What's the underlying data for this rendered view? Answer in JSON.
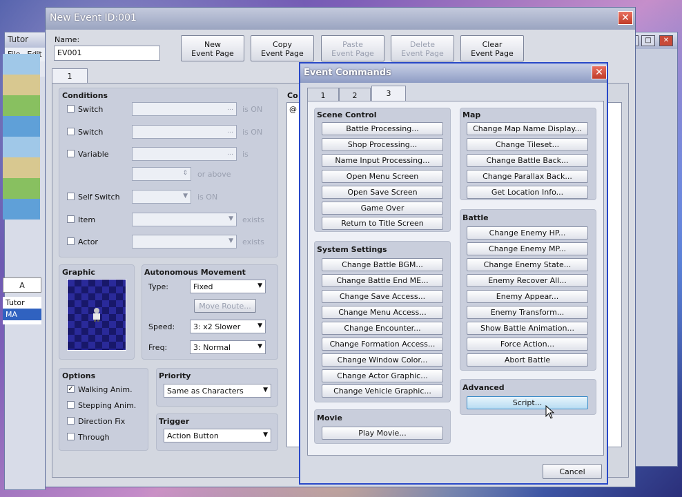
{
  "back_window": {
    "title": "Tutor",
    "menu": [
      "File",
      "Edit"
    ],
    "tab": "A",
    "tree": [
      {
        "label": "Tutor",
        "selected": false
      },
      {
        "label": "MA",
        "selected": true
      }
    ]
  },
  "main_window": {
    "title": "New Event   ID:001",
    "name_label": "Name:",
    "name_value": "EV001",
    "page_buttons": [
      {
        "label": "New\nEvent Page",
        "enabled": true
      },
      {
        "label": "Copy\nEvent Page",
        "enabled": true
      },
      {
        "label": "Paste\nEvent Page",
        "enabled": false
      },
      {
        "label": "Delete\nEvent Page",
        "enabled": false
      },
      {
        "label": "Clear\nEvent Page",
        "enabled": true
      }
    ],
    "page_tab": "1",
    "conditions": {
      "title": "Conditions",
      "switch1": {
        "label": "Switch",
        "suffix": "is ON",
        "dots": "..."
      },
      "switch2": {
        "label": "Switch",
        "suffix": "is ON",
        "dots": "..."
      },
      "variable": {
        "label": "Variable",
        "suffix": "is",
        "dots": "...",
        "above": "or above"
      },
      "self_switch": {
        "label": "Self Switch",
        "suffix": "is ON"
      },
      "item": {
        "label": "Item",
        "suffix": "exists"
      },
      "actor": {
        "label": "Actor",
        "suffix": "exists"
      }
    },
    "graphic": {
      "title": "Graphic"
    },
    "autonomous": {
      "title": "Autonomous Movement",
      "type_label": "Type:",
      "type_value": "Fixed",
      "move_route": "Move Route...",
      "speed_label": "Speed:",
      "speed_value": "3: x2 Slower",
      "freq_label": "Freq:",
      "freq_value": "3: Normal"
    },
    "options": {
      "title": "Options",
      "items": [
        {
          "label": "Walking Anim.",
          "checked": true
        },
        {
          "label": "Stepping Anim.",
          "checked": false
        },
        {
          "label": "Direction Fix",
          "checked": false
        },
        {
          "label": "Through",
          "checked": false
        }
      ]
    },
    "priority": {
      "title": "Priority",
      "value": "Same as Characters"
    },
    "trigger": {
      "title": "Trigger",
      "value": "Action Button"
    },
    "contents_label": "Co",
    "contents_first": "@"
  },
  "event_commands": {
    "title": "Event Commands",
    "tabs": [
      "1",
      "2",
      "3"
    ],
    "active_tab": "3",
    "scene_control": {
      "title": "Scene Control",
      "items": [
        "Battle Processing...",
        "Shop Processing...",
        "Name Input Processing...",
        "Open Menu Screen",
        "Open Save Screen",
        "Game Over",
        "Return to Title Screen"
      ]
    },
    "system_settings": {
      "title": "System Settings",
      "items": [
        "Change Battle BGM...",
        "Change Battle End ME...",
        "Change Save Access...",
        "Change Menu Access...",
        "Change Encounter...",
        "Change Formation Access...",
        "Change Window Color...",
        "Change Actor Graphic...",
        "Change Vehicle Graphic..."
      ]
    },
    "movie": {
      "title": "Movie",
      "items": [
        "Play Movie..."
      ]
    },
    "map": {
      "title": "Map",
      "items": [
        "Change Map Name Display...",
        "Change Tileset...",
        "Change Battle Back...",
        "Change Parallax Back...",
        "Get Location Info..."
      ]
    },
    "battle": {
      "title": "Battle",
      "items": [
        "Change Enemy HP...",
        "Change Enemy MP...",
        "Change Enemy State...",
        "Enemy Recover All...",
        "Enemy Appear...",
        "Enemy Transform...",
        "Show Battle Animation...",
        "Force Action...",
        "Abort Battle"
      ]
    },
    "advanced": {
      "title": "Advanced",
      "items": [
        "Script..."
      ]
    },
    "cancel": "Cancel"
  },
  "colors": {
    "accent_border": "#2848c8",
    "close_red": "#c03a28",
    "highlight": "#b8dcf2"
  },
  "icons": [
    "close-icon",
    "checkbox-icon",
    "dropdown-arrow-icon",
    "mouse-cursor-icon",
    "tree-map-icon"
  ]
}
